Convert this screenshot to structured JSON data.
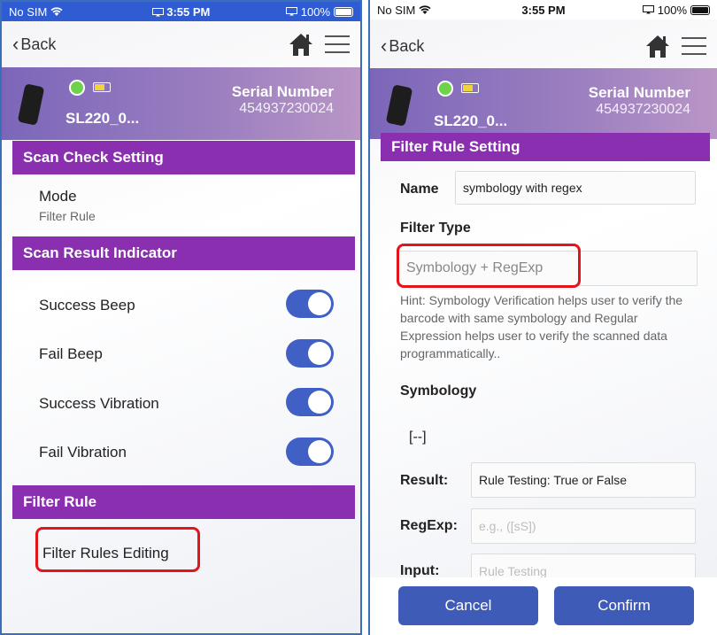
{
  "status": {
    "carrier": "No SIM",
    "time": "3:55 PM",
    "battery": "100%"
  },
  "nav": {
    "back": "Back"
  },
  "device": {
    "name": "SL220_0...",
    "serial_label": "Serial Number",
    "serial_value": "454937230024"
  },
  "left": {
    "section_scan_check": "Scan Check Setting",
    "mode_label": "Mode",
    "mode_value": "Filter Rule",
    "section_indicator": "Scan Result Indicator",
    "toggles": [
      {
        "label": "Success Beep",
        "on": true
      },
      {
        "label": "Fail Beep",
        "on": true
      },
      {
        "label": "Success Vibration",
        "on": true
      },
      {
        "label": "Fail Vibration",
        "on": true
      }
    ],
    "section_filter_rule": "Filter Rule",
    "filter_rules_editing": "Filter Rules Editing"
  },
  "right": {
    "section_title": "Filter Rule Setting",
    "name_label": "Name",
    "name_value": "symbology with regex",
    "filter_type_label": "Filter Type",
    "filter_type_value": "Symbology + RegExp",
    "hint": "Hint: Symbology Verification helps user to verify the barcode with same symbology and Regular Expression helps user to  verify the scanned data programmatically..",
    "symbology_label": "Symbology",
    "symbology_value": "[--]",
    "result_label": "Result:",
    "result_value": "Rule Testing: True or False",
    "regexp_label": "RegExp:",
    "regexp_placeholder": "e.g., ([sS])",
    "input_label": "Input:",
    "input_placeholder": "Rule Testing",
    "cancel": "Cancel",
    "confirm": "Confirm"
  },
  "colors": {
    "accent": "#8a2fb0",
    "button": "#3f5bb8",
    "toggle": "#4060c6",
    "highlight": "#e3141b"
  }
}
